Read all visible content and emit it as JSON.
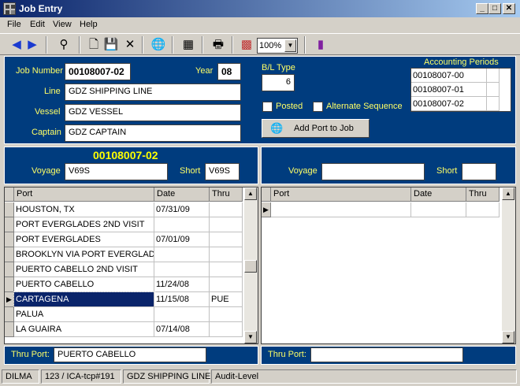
{
  "window": {
    "title": "Job Entry"
  },
  "menu": [
    "File",
    "Edit",
    "View",
    "Help"
  ],
  "toolbar": {
    "zoom": "100%"
  },
  "job": {
    "number_label": "Job Number",
    "number": "00108007-02",
    "year_label": "Year",
    "year": "08",
    "line_label": "Line",
    "line": "GDZ SHIPPING LINE",
    "vessel_label": "Vessel",
    "vessel": "GDZ VESSEL",
    "captain_label": "Captain",
    "captain": "GDZ CAPTAIN",
    "bl_type_label": "B/L Type",
    "bl_type": "6",
    "posted_label": "Posted",
    "alt_seq_label": "Alternate Sequence",
    "add_port_label": "Add Port to Job"
  },
  "accounting": {
    "title": "Accounting Periods",
    "rows": [
      "00108007-00",
      "00108007-01",
      "00108007-02"
    ]
  },
  "left_voyage": {
    "heading": "00108007-02",
    "voyage_label": "Voyage",
    "voyage": "V69S",
    "short_label": "Short",
    "short": "V69S"
  },
  "right_voyage": {
    "voyage_label": "Voyage",
    "voyage": "",
    "short_label": "Short",
    "short": ""
  },
  "left_grid": {
    "columns": [
      "Port",
      "Date",
      "Thru"
    ],
    "rows": [
      [
        "HOUSTON, TX",
        "07/31/09",
        ""
      ],
      [
        "PORT EVERGLADES 2ND VISIT",
        "",
        ""
      ],
      [
        "PORT EVERGLADES",
        "07/01/09",
        ""
      ],
      [
        "BROOKLYN VIA PORT EVERGLADES",
        "",
        ""
      ],
      [
        "PUERTO CABELLO 2ND VISIT",
        "",
        ""
      ],
      [
        "PUERTO CABELLO",
        "11/24/08",
        ""
      ],
      [
        "CARTAGENA",
        "11/15/08",
        "PUE"
      ],
      [
        "PALUA",
        "",
        ""
      ],
      [
        "LA GUAIRA",
        "07/14/08",
        ""
      ]
    ],
    "selected_index": 6
  },
  "right_grid": {
    "columns": [
      "Port",
      "Date",
      "Thru"
    ]
  },
  "thru_left": {
    "label": "Thru Port:",
    "value": "PUERTO CABELLO"
  },
  "thru_right": {
    "label": "Thru Port:",
    "value": ""
  },
  "status": [
    "DILMA",
    "123 / ICA-tcp#191",
    "GDZ SHIPPING LINE",
    "Audit-Level"
  ]
}
